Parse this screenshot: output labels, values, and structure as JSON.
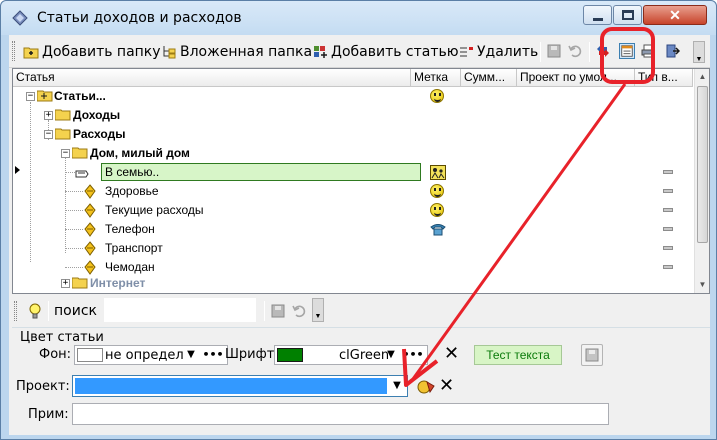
{
  "window": {
    "title": "Статьи доходов и расходов",
    "close_glyph": "✕"
  },
  "toolbar": {
    "add_folder_label": "Добавить папку",
    "nested_folder_label": "Вложенная папка",
    "add_item_label": "Добавить статью",
    "delete_label": "Удалить"
  },
  "grid": {
    "columns": [
      "Статья",
      "Метка",
      "Сумм...",
      "Проект по умол...",
      "Тип в..."
    ],
    "rows": [
      {
        "label": "Статьи...",
        "bold": true
      },
      {
        "label": "Доходы",
        "bold": true
      },
      {
        "label": "Расходы",
        "bold": true
      },
      {
        "label": "Дом, милый дом",
        "bold": true
      },
      {
        "label": "В семью..",
        "selected": true
      },
      {
        "label": "Здоровье"
      },
      {
        "label": "Текущие расходы"
      },
      {
        "label": "Телефон"
      },
      {
        "label": "Транспорт"
      },
      {
        "label": "Чемодан"
      },
      {
        "label": "Интернет",
        "bold": true,
        "muted": true
      }
    ],
    "icons": {
      "row_mark": "smiley-icon",
      "phone_mark": "telephone-icon",
      "family_mark": "family-icon"
    }
  },
  "search": {
    "label": "поиск",
    "value": ""
  },
  "color_group": {
    "title": "Цвет статьи",
    "background_label": "Фон:",
    "background_value": "не определ",
    "font_label": "Шрифт:",
    "font_value": "clGreen",
    "font_color": "#008000",
    "test_text": "Тест текста"
  },
  "project": {
    "label": "Проект:",
    "value": "",
    "highlight_color": "#3399ff"
  },
  "note": {
    "label": "Прим:",
    "value": ""
  },
  "annotation": {
    "color": "#e8222a"
  }
}
